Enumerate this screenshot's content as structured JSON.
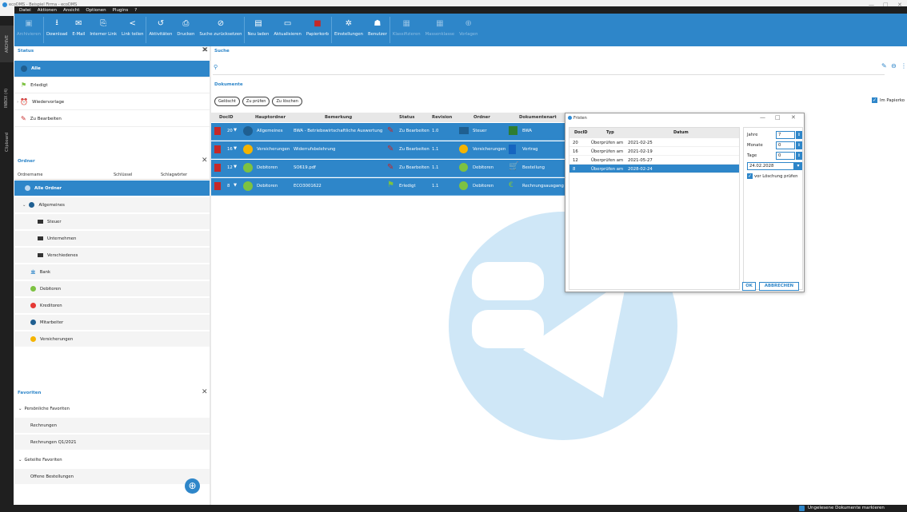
{
  "window": {
    "title": "ecoDMS - Beispiel Firma - ecoDMS",
    "min": "—",
    "max": "□",
    "close": "✕"
  },
  "menu": [
    "Datei",
    "Aktionen",
    "Ansicht",
    "Optionen",
    "Plugins",
    "?"
  ],
  "ribbon": [
    {
      "label": "Archivieren",
      "icon": "archive-icon",
      "disabled": true
    },
    {
      "label": "Download",
      "icon": "download-icon",
      "disabled": false
    },
    {
      "label": "E-Mail",
      "icon": "mail-icon",
      "disabled": false
    },
    {
      "label": "Interner Link",
      "icon": "link-icon",
      "disabled": false
    },
    {
      "label": "Link teilen",
      "icon": "share-icon",
      "disabled": false
    },
    {
      "label": "Aktivitäten",
      "icon": "history-icon",
      "disabled": false
    },
    {
      "label": "Drucken",
      "icon": "print-icon",
      "disabled": false
    },
    {
      "label": "Suche zurücksetzen",
      "icon": "reset-search-icon",
      "disabled": false
    },
    {
      "label": "Neu laden",
      "icon": "reload-icon",
      "disabled": false
    },
    {
      "label": "Aktualisieren",
      "icon": "refresh-icon",
      "disabled": false
    },
    {
      "label": "Papierkorb",
      "icon": "trash-icon",
      "disabled": false
    },
    {
      "label": "Einstellungen",
      "icon": "settings-icon",
      "disabled": false
    },
    {
      "label": "Benutzer",
      "icon": "user-icon",
      "disabled": false
    },
    {
      "label": "Klassifizieren",
      "icon": "classify-icon",
      "disabled": true
    },
    {
      "label": "Massenklasse",
      "icon": "mass-classify-icon",
      "disabled": true
    },
    {
      "label": "Vorlagen",
      "icon": "template-icon",
      "disabled": true
    }
  ],
  "side_tabs": [
    "ARCHIVE",
    "INBOX (4)",
    "Clipboard"
  ],
  "status": {
    "title": "Status",
    "items": [
      {
        "label": "Alle",
        "selected": true
      },
      {
        "label": "Erledigt",
        "selected": false
      },
      {
        "label": "Wiedervorlage",
        "selected": false
      },
      {
        "label": "Zu Bearbeiten",
        "selected": false
      }
    ]
  },
  "folders": {
    "title": "Ordner",
    "columns": [
      "Ordnername",
      "Schlüssel",
      "Schlagwörter"
    ],
    "items": [
      {
        "label": "Alle Ordner",
        "level": 0,
        "selected": true
      },
      {
        "label": "Allgemeines",
        "level": 0,
        "selected": false
      },
      {
        "label": "Steuer",
        "level": 1,
        "selected": false
      },
      {
        "label": "Unternehmen",
        "level": 1,
        "selected": false
      },
      {
        "label": "Verschiedenes",
        "level": 1,
        "selected": false
      },
      {
        "label": "Bank",
        "level": 0,
        "selected": false
      },
      {
        "label": "Debitoren",
        "level": 0,
        "selected": false
      },
      {
        "label": "Kreditoren",
        "level": 0,
        "selected": false
      },
      {
        "label": "Mitarbeiter",
        "level": 0,
        "selected": false
      },
      {
        "label": "Versicherungen",
        "level": 0,
        "selected": false
      }
    ]
  },
  "favorites": {
    "title": "Favoriten",
    "items": [
      {
        "label": "Persönliche Favoriten",
        "group": true
      },
      {
        "label": "Rechnungen",
        "group": false
      },
      {
        "label": "Rechnungen Q1/2021",
        "group": false
      },
      {
        "label": "Geteilte Favoriten",
        "group": true
      },
      {
        "label": "Offene Bestellungen",
        "group": false
      }
    ]
  },
  "search": {
    "title": "Suche",
    "placeholder": ""
  },
  "documents": {
    "title": "Dokumente",
    "filters": [
      "Gelöscht",
      "Zu prüfen",
      "Zu löschen"
    ],
    "columns": [
      "DocID",
      "Hauptordner",
      "Bemerkung",
      "Status",
      "Revision",
      "Ordner",
      "Dokumentenart"
    ],
    "rows": [
      {
        "id": "20",
        "main": "Allgemeines",
        "note": "BWA - Betriebswirtschaftliche Auswertung",
        "status": "Zu Bearbeiten",
        "rev": "1.0",
        "folder": "Steuer",
        "type": "BWA"
      },
      {
        "id": "16",
        "main": "Versicherungen",
        "note": "Widerrufsbelehrung",
        "status": "Zu Bearbeiten",
        "rev": "1.1",
        "folder": "Versicherungen",
        "type": "Vertrag"
      },
      {
        "id": "12",
        "main": "Debitoren",
        "note": "SO619.pdf",
        "status": "Zu Bearbeiten",
        "rev": "1.1",
        "folder": "Debitoren",
        "type": "Bestellung"
      },
      {
        "id": "8",
        "main": "Debitoren",
        "note": "ECO3001622",
        "status": "Erledigt",
        "rev": "1.1",
        "folder": "Debitoren",
        "type": "Rechnungsausgang"
      }
    ]
  },
  "paperbin_label": "Im Papierko",
  "dialog": {
    "title": "Fristen",
    "columns": [
      "DocID",
      "Typ",
      "Datum"
    ],
    "rows": [
      {
        "id": "20",
        "typ": "Überprüfen am",
        "date": "2021-02-25",
        "selected": false
      },
      {
        "id": "16",
        "typ": "Überprüfen am",
        "date": "2021-02-19",
        "selected": false
      },
      {
        "id": "12",
        "typ": "Überprüfen am",
        "date": "2021-05-27",
        "selected": false
      },
      {
        "id": "8",
        "typ": "Überprüfen am",
        "date": "2028-02-24",
        "selected": true
      }
    ],
    "jahre_label": "Jahre",
    "jahre": "7",
    "monate_label": "Monate",
    "monate": "0",
    "tage_label": "Tage",
    "tage": "0",
    "date_value": "24.02.2028",
    "check_label": "vor Löschung prüfen",
    "ok": "OK",
    "cancel": "ABBRECHEN"
  },
  "statusbar": {
    "label": "Ungelesene Dokumente markieren"
  },
  "colors": {
    "accent": "#2e86c9",
    "dark": "#1f1f1f"
  }
}
